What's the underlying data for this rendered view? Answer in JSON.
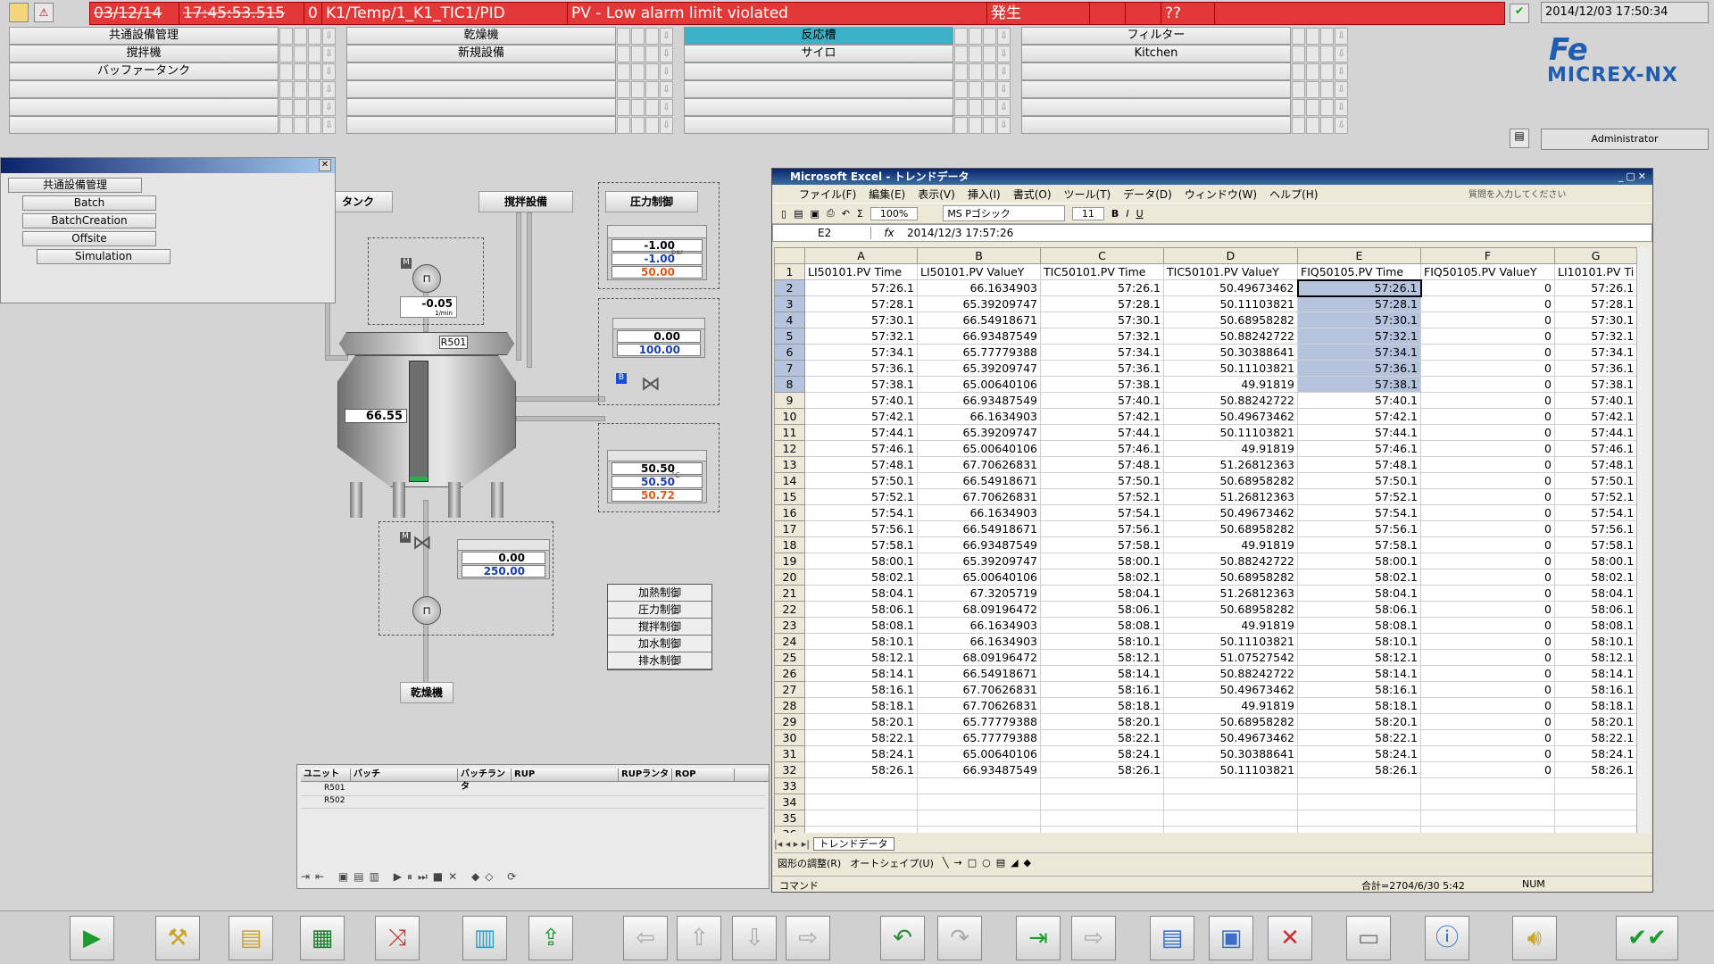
{
  "header": {
    "date": "03/12/14",
    "time": "17:45:53.515",
    "seq": "0",
    "tag": "K1/Temp/1_K1_TIC1/PID",
    "message": "PV - Low alarm limit violated",
    "status": "発生",
    "extra": "??",
    "clock": "2014/12/03 17:50:34",
    "user": "Administrator"
  },
  "units": [
    [
      "共通設備管理",
      "乾燥機",
      "反応槽",
      "フィルター"
    ],
    [
      "撹拌機",
      "新規設備",
      "サイロ",
      "Kitchen"
    ],
    [
      "バッファータンク",
      "",
      "",
      ""
    ],
    [
      "",
      "",
      "",
      ""
    ],
    [
      "",
      "",
      "",
      ""
    ],
    [
      "",
      "",
      "",
      ""
    ]
  ],
  "logo": {
    "fe": "Fe",
    "name": "MICREX-NX"
  },
  "tree": {
    "items": [
      "共通設備管理",
      "Batch",
      "BatchCreation",
      "Offsite",
      "Simulation"
    ]
  },
  "process": {
    "tank_btn": "タンク",
    "agitator_btn": "撹拌設備",
    "pressure_btn": "圧力制御",
    "dryer_btn": "乾燥機",
    "vessel": "R501",
    "level": "66.55",
    "motor": {
      "value": "-0.05",
      "unit": "1/min"
    },
    "pressure": {
      "pv": "-1.00",
      "sv": "-1.00",
      "mv": "50.00",
      "unit": "bar",
      "pct": "%"
    },
    "valve2": {
      "pv": "0.00",
      "sv": "100.00"
    },
    "temp": {
      "pv": "50.50",
      "sv": "50.50",
      "mv": "50.72",
      "unit": "°C",
      "pct": "%"
    },
    "flow": {
      "pv": "0.00",
      "sv": "250.00"
    },
    "controls": [
      "加熱制御",
      "圧力制御",
      "撹拌制御",
      "加水制御",
      "排水制御"
    ]
  },
  "batch": {
    "headers": [
      "ユニット",
      "バッチ",
      "バッチランタ",
      "RUP",
      "RUPランタ",
      "ROP"
    ],
    "rows": [
      "R501",
      "R502"
    ]
  },
  "excel": {
    "title": "Microsoft Excel - トレンドデータ",
    "menu": [
      "ファイル(F)",
      "編集(E)",
      "表示(V)",
      "挿入(I)",
      "書式(O)",
      "ツール(T)",
      "データ(D)",
      "ウィンドウ(W)",
      "ヘルプ(H)"
    ],
    "help_placeholder": "質問を入力してください",
    "font": "MS Pゴシック",
    "size": "11",
    "zoom": "100%",
    "cell": "E2",
    "formula": "2014/12/3  17:57:26",
    "cols": [
      "A",
      "B",
      "C",
      "D",
      "E",
      "F",
      "G"
    ],
    "headers": [
      "LI50101.PV Time",
      "LI50101.PV ValueY",
      "TIC50101.PV Time",
      "TIC50101.PV ValueY",
      "FIQ50105.PV Time",
      "FIQ50105.PV ValueY",
      "LI10101.PV Ti"
    ],
    "rows": [
      [
        "57:26.1",
        "66.1634903",
        "57:26.1",
        "50.49673462",
        "57:26.1",
        "0",
        "57:26.1"
      ],
      [
        "57:28.1",
        "65.39209747",
        "57:28.1",
        "50.11103821",
        "57:28.1",
        "0",
        "57:28.1"
      ],
      [
        "57:30.1",
        "66.54918671",
        "57:30.1",
        "50.68958282",
        "57:30.1",
        "0",
        "57:30.1"
      ],
      [
        "57:32.1",
        "66.93487549",
        "57:32.1",
        "50.88242722",
        "57:32.1",
        "0",
        "57:32.1"
      ],
      [
        "57:34.1",
        "65.77779388",
        "57:34.1",
        "50.30388641",
        "57:34.1",
        "0",
        "57:34.1"
      ],
      [
        "57:36.1",
        "65.39209747",
        "57:36.1",
        "50.11103821",
        "57:36.1",
        "0",
        "57:36.1"
      ],
      [
        "57:38.1",
        "65.00640106",
        "57:38.1",
        "49.91819",
        "57:38.1",
        "0",
        "57:38.1"
      ],
      [
        "57:40.1",
        "66.93487549",
        "57:40.1",
        "50.88242722",
        "57:40.1",
        "0",
        "57:40.1"
      ],
      [
        "57:42.1",
        "66.1634903",
        "57:42.1",
        "50.49673462",
        "57:42.1",
        "0",
        "57:42.1"
      ],
      [
        "57:44.1",
        "65.39209747",
        "57:44.1",
        "50.11103821",
        "57:44.1",
        "0",
        "57:44.1"
      ],
      [
        "57:46.1",
        "65.00640106",
        "57:46.1",
        "49.91819",
        "57:46.1",
        "0",
        "57:46.1"
      ],
      [
        "57:48.1",
        "67.70626831",
        "57:48.1",
        "51.26812363",
        "57:48.1",
        "0",
        "57:48.1"
      ],
      [
        "57:50.1",
        "66.54918671",
        "57:50.1",
        "50.68958282",
        "57:50.1",
        "0",
        "57:50.1"
      ],
      [
        "57:52.1",
        "67.70626831",
        "57:52.1",
        "51.26812363",
        "57:52.1",
        "0",
        "57:52.1"
      ],
      [
        "57:54.1",
        "66.1634903",
        "57:54.1",
        "50.49673462",
        "57:54.1",
        "0",
        "57:54.1"
      ],
      [
        "57:56.1",
        "66.54918671",
        "57:56.1",
        "50.68958282",
        "57:56.1",
        "0",
        "57:56.1"
      ],
      [
        "57:58.1",
        "66.93487549",
        "57:58.1",
        "49.91819",
        "57:58.1",
        "0",
        "57:58.1"
      ],
      [
        "58:00.1",
        "65.39209747",
        "58:00.1",
        "50.88242722",
        "58:00.1",
        "0",
        "58:00.1"
      ],
      [
        "58:02.1",
        "65.00640106",
        "58:02.1",
        "50.68958282",
        "58:02.1",
        "0",
        "58:02.1"
      ],
      [
        "58:04.1",
        "67.3205719",
        "58:04.1",
        "51.26812363",
        "58:04.1",
        "0",
        "58:04.1"
      ],
      [
        "58:06.1",
        "68.09196472",
        "58:06.1",
        "50.68958282",
        "58:06.1",
        "0",
        "58:06.1"
      ],
      [
        "58:08.1",
        "66.1634903",
        "58:08.1",
        "49.91819",
        "58:08.1",
        "0",
        "58:08.1"
      ],
      [
        "58:10.1",
        "66.1634903",
        "58:10.1",
        "50.11103821",
        "58:10.1",
        "0",
        "58:10.1"
      ],
      [
        "58:12.1",
        "68.09196472",
        "58:12.1",
        "51.07527542",
        "58:12.1",
        "0",
        "58:12.1"
      ],
      [
        "58:14.1",
        "66.54918671",
        "58:14.1",
        "50.88242722",
        "58:14.1",
        "0",
        "58:14.1"
      ],
      [
        "58:16.1",
        "67.70626831",
        "58:16.1",
        "50.49673462",
        "58:16.1",
        "0",
        "58:16.1"
      ],
      [
        "58:18.1",
        "67.70626831",
        "58:18.1",
        "49.91819",
        "58:18.1",
        "0",
        "58:18.1"
      ],
      [
        "58:20.1",
        "65.77779388",
        "58:20.1",
        "50.68958282",
        "58:20.1",
        "0",
        "58:20.1"
      ],
      [
        "58:22.1",
        "65.77779388",
        "58:22.1",
        "50.49673462",
        "58:22.1",
        "0",
        "58:22.1"
      ],
      [
        "58:24.1",
        "65.00640106",
        "58:24.1",
        "50.30388641",
        "58:24.1",
        "0",
        "58:24.1"
      ],
      [
        "58:26.1",
        "66.93487549",
        "58:26.1",
        "50.11103821",
        "58:26.1",
        "0",
        "58:26.1"
      ]
    ],
    "sheet_tab": "トレンドデータ",
    "draw": "図形の調整(R)",
    "autoshape": "オートシェイプ(U)",
    "status_left": "コマンド",
    "status_sum": "合計=2704/6/30 5:42",
    "status_num": "NUM"
  },
  "colors": {
    "alarm": "#e33838",
    "active_unit": "#3bb1c8",
    "excel_title": "#0a246a"
  }
}
